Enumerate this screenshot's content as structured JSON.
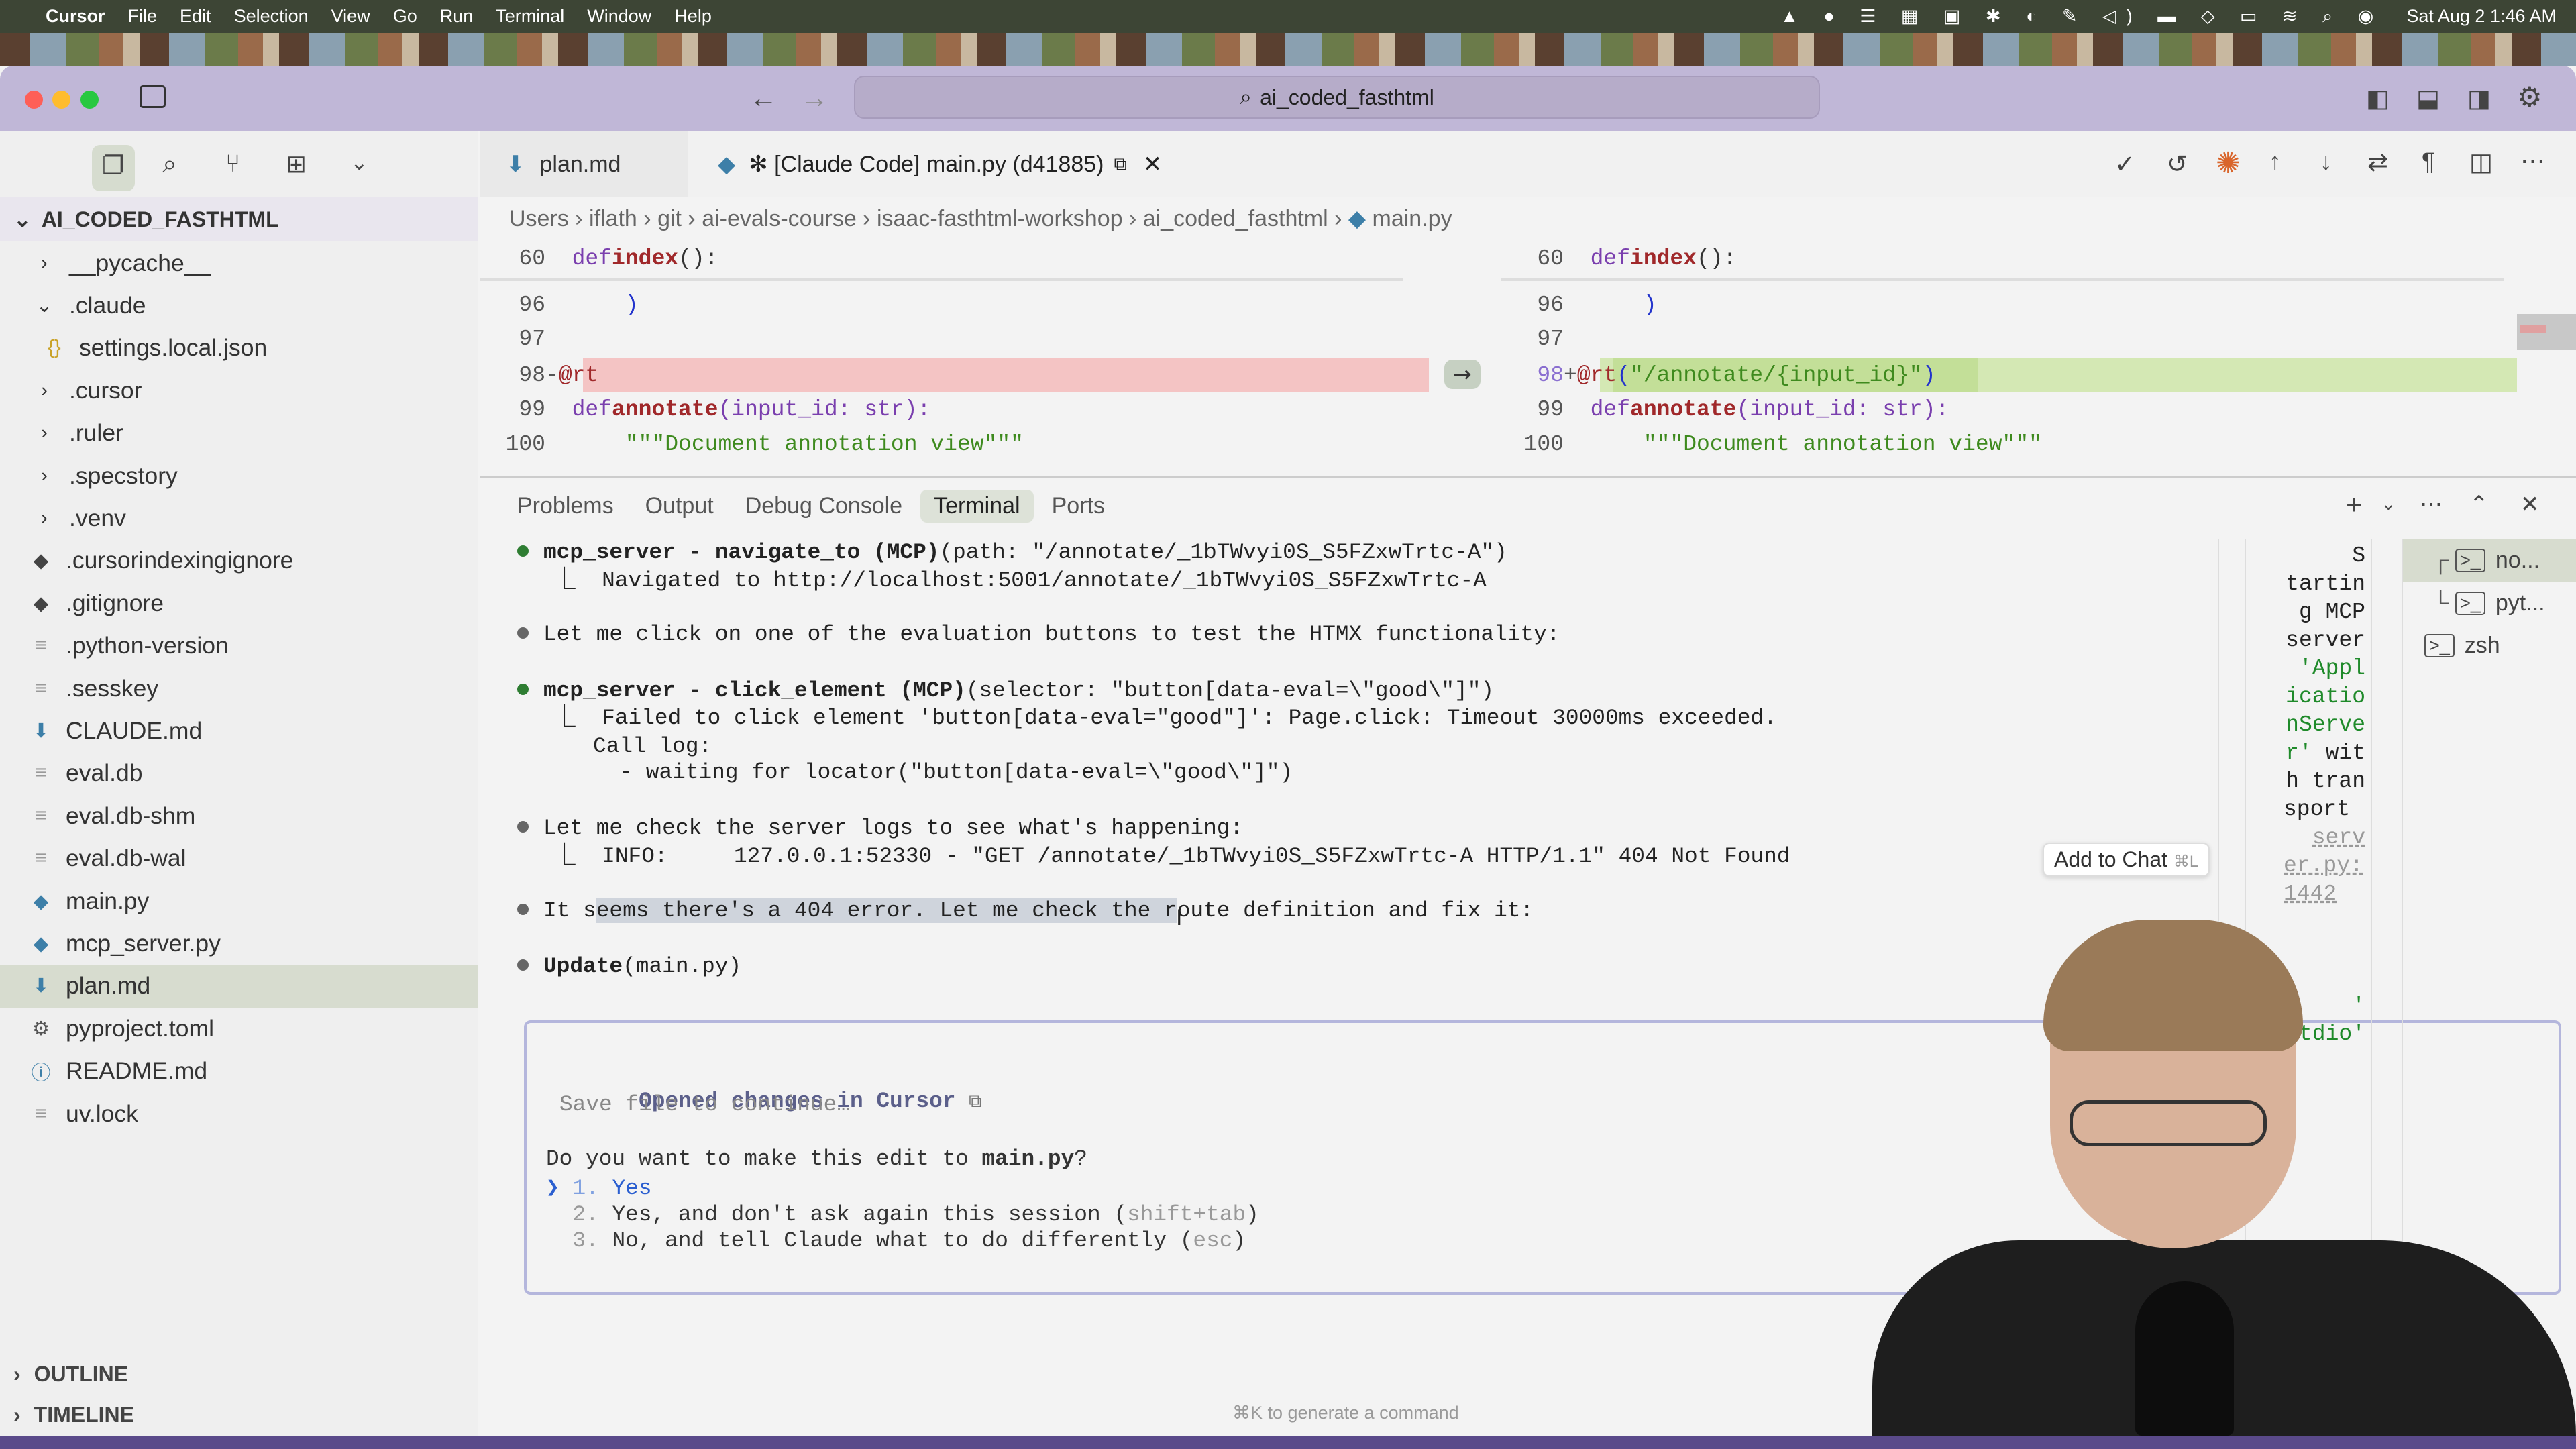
{
  "menubar": {
    "app": "Cursor",
    "items": [
      "File",
      "Edit",
      "Selection",
      "View",
      "Go",
      "Run",
      "Terminal",
      "Window",
      "Help"
    ],
    "clock": "Sat Aug 2  1:46 AM"
  },
  "titlebar": {
    "search": "ai_coded_fasthtml"
  },
  "tabs": [
    {
      "label": "plan.md"
    },
    {
      "label": "✻ [Claude Code] main.py (d41885)"
    }
  ],
  "sidebar": {
    "title": "AI_CODED_FASTHTML",
    "items": [
      {
        "label": "__pycache__",
        "icon": "chevron-right"
      },
      {
        "label": ".claude",
        "icon": "chevron-down"
      },
      {
        "label": "settings.local.json",
        "icon": "braces"
      },
      {
        "label": ".cursor",
        "icon": "chevron-right"
      },
      {
        "label": ".ruler",
        "icon": "chevron-right"
      },
      {
        "label": ".specstory",
        "icon": "chevron-right"
      },
      {
        "label": ".venv",
        "icon": "chevron-right"
      },
      {
        "label": ".cursorindexingignore",
        "icon": "git"
      },
      {
        "label": ".gitignore",
        "icon": "git"
      },
      {
        "label": ".python-version",
        "icon": "lines"
      },
      {
        "label": ".sesskey",
        "icon": "lines"
      },
      {
        "label": "CLAUDE.md",
        "icon": "markdown"
      },
      {
        "label": "eval.db",
        "icon": "lines"
      },
      {
        "label": "eval.db-shm",
        "icon": "lines"
      },
      {
        "label": "eval.db-wal",
        "icon": "lines"
      },
      {
        "label": "main.py",
        "icon": "python"
      },
      {
        "label": "mcp_server.py",
        "icon": "python"
      },
      {
        "label": "plan.md",
        "icon": "markdown"
      },
      {
        "label": "pyproject.toml",
        "icon": "gear"
      },
      {
        "label": "README.md",
        "icon": "info"
      },
      {
        "label": "uv.lock",
        "icon": "lines"
      }
    ],
    "outline": "OUTLINE",
    "timeline": "TIMELINE"
  },
  "breadcrumb": [
    "Users",
    "iflath",
    "git",
    "ai-evals-course",
    "isaac-fasthtml-workshop",
    "ai_coded_fasthtml",
    "main.py"
  ],
  "diff": {
    "lines": {
      "l60": "60",
      "l96": "96",
      "l97": "97",
      "l98": "98",
      "l99": "99",
      "l100": "100"
    },
    "sticky": {
      "kw": "def",
      "fn": "index",
      "rest": "():"
    },
    "close_paren": ")",
    "left98": "@rt",
    "right98": {
      "at": "@rt",
      "open": "(",
      "str": "\"/annotate/{input_id}\"",
      "close": ")"
    },
    "line99": {
      "kw": "def",
      "fn": "annotate",
      "args": "(input_id: str):"
    },
    "line100": "\"\"\"Document annotation view\"\"\""
  },
  "panel": {
    "tabs": [
      "Problems",
      "Output",
      "Debug Console",
      "Terminal",
      "Ports"
    ],
    "active": "Terminal"
  },
  "terminal": {
    "t1_bold": "mcp_server - navigate_to (MCP)",
    "t1_rest": "(path: \"/annotate/_1bTWvyi0S_S5FZxwTrtc-A\")",
    "t1_out": "⎿  Navigated to http://localhost:5001/annotate/_1bTWvyi0S_S5FZxwTrtc-A",
    "t2": "Let me click on one of the evaluation buttons to test the HTMX functionality:",
    "t3_bold": "mcp_server - click_element (MCP)",
    "t3_rest": "(selector: \"button[data-eval=\\\"good\\\"]\")",
    "t3_out1": "⎿  Failed to click element 'button[data-eval=\"good\"]': Page.click: Timeout 30000ms exceeded.",
    "t3_out2": "   Call log:",
    "t3_out3": "     - waiting for locator(\"button[data-eval=\\\"good\\\"]\")",
    "t4": "Let me check the server logs to see what's happening:",
    "t4_out": "⎿  INFO:     127.0.0.1:52330 - \"GET /annotate/_1bTWvyi0S_S5FZxwTrtc-A HTTP/1.1\" 404 Not Found",
    "t5_a": "It s",
    "t5_sel": "eems there's a 404 error. Let me check the r",
    "t5_b": "oute definition and fix it:",
    "t6_bold": "Update",
    "t6_rest": "(main.py)",
    "add_to_chat": "Add to Chat",
    "add_to_chat_shortcut": "⌘L",
    "generate_hint": "⌘K to generate a command"
  },
  "dialog": {
    "opened": "Opened changes in Cursor",
    "save_hint": "Save file to continue…",
    "question_a": "Do you want to make this edit to ",
    "question_file": "main.py",
    "question_b": "?",
    "options": [
      {
        "num": "1.",
        "label": "Yes",
        "hint": ""
      },
      {
        "num": "2.",
        "label": "Yes, and don't ask again this session (",
        "hint": "shift+tab"
      },
      {
        "num": "3.",
        "label": "No, and tell Claude what to do differently (",
        "hint": "esc"
      }
    ],
    "close": ")"
  },
  "right_terminal": {
    "lines": [
      "S",
      "tartin",
      "g MCP",
      "server"
    ],
    "green": [
      "'Appl",
      "icatio",
      "nServe",
      "r'"
    ],
    "tail": [
      " wit",
      "h tran",
      "sport"
    ],
    "link": [
      "serv",
      "er.py:",
      "1442"
    ],
    "end_green": [
      "'",
      "stdio'"
    ]
  },
  "terminal_list": [
    {
      "label": "no..."
    },
    {
      "label": "pyt..."
    },
    {
      "label": "zsh"
    }
  ],
  "colors": {
    "accent": "#c0b7d7",
    "deleted": "#f4c4c4",
    "added": "#d4e8b4",
    "selected": "#d7dccf"
  }
}
